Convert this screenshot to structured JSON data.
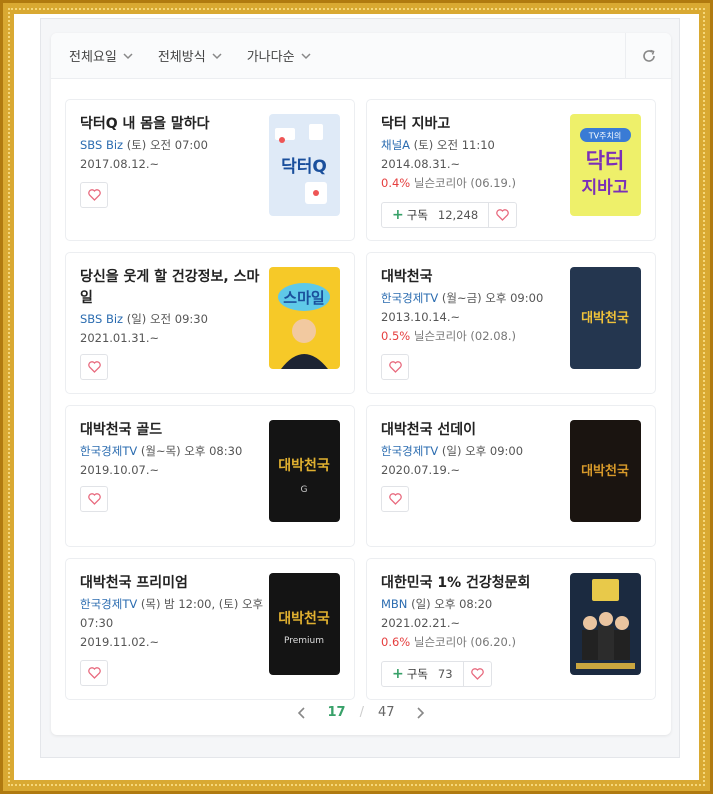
{
  "filters": [
    {
      "label": "전체요일"
    },
    {
      "label": "전체방식"
    },
    {
      "label": "가나다순"
    }
  ],
  "colors": {
    "accent": "#38a169",
    "channel": "#2b6cb0",
    "rating": "#e53e3e",
    "frame": "#d9a932"
  },
  "cards": [
    {
      "title": "닥터Q 내 몸을 말하다",
      "channel": "SBS Biz",
      "schedule": " (토) 오전 07:00",
      "date": "2017.08.12.~"
    },
    {
      "title": "닥터 지바고",
      "channel": "채널A",
      "schedule": " (토) 오전 11:10",
      "date": "2014.08.31.~",
      "rating": "0.4%",
      "rating_src": " 닐슨코리아 (06.19.)",
      "subscribe_label": "구독",
      "subscribers": "12,248"
    },
    {
      "title": "당신을 웃게 할 건강정보, 스마일",
      "channel": "SBS Biz",
      "schedule": " (일) 오전 09:30",
      "date": "2021.01.31.~"
    },
    {
      "title": "대박천국",
      "channel": "한국경제TV",
      "schedule": " (월~금) 오후 09:00",
      "date": "2013.10.14.~",
      "rating": "0.5%",
      "rating_src": " 닐슨코리아 (02.08.)"
    },
    {
      "title": "대박천국 골드",
      "channel": "한국경제TV",
      "schedule": " (월~목) 오후 08:30",
      "date": "2019.10.07.~"
    },
    {
      "title": "대박천국 선데이",
      "channel": "한국경제TV",
      "schedule": " (일) 오후 09:00",
      "date": "2020.07.19.~"
    },
    {
      "title": "대박천국 프리미엄",
      "channel": "한국경제TV",
      "schedule": " (목) 밤 12:00, (토) 오후 07:30",
      "date": "2019.11.02.~"
    },
    {
      "title": "대한민국 1% 건강청문회",
      "channel": "MBN",
      "schedule": " (일) 오후 08:20",
      "date": "2021.02.21.~",
      "rating": "0.6%",
      "rating_src": " 닐슨코리아 (06.20.)",
      "subscribe_label": "구독",
      "subscribers": "73"
    }
  ],
  "thumbs": {
    "t1": "닥터Q",
    "t2_badge": "TV주치의",
    "t2_a": "닥터",
    "t2_b": "지바고",
    "t3": "스마일",
    "t4": "대박천국",
    "t5": "대박천국",
    "t5_sub": "G",
    "t6": "대박천국",
    "t7": "대박천국",
    "t7_sub": "Premium"
  },
  "pager": {
    "current": "17",
    "separator": "/",
    "total": "47"
  }
}
